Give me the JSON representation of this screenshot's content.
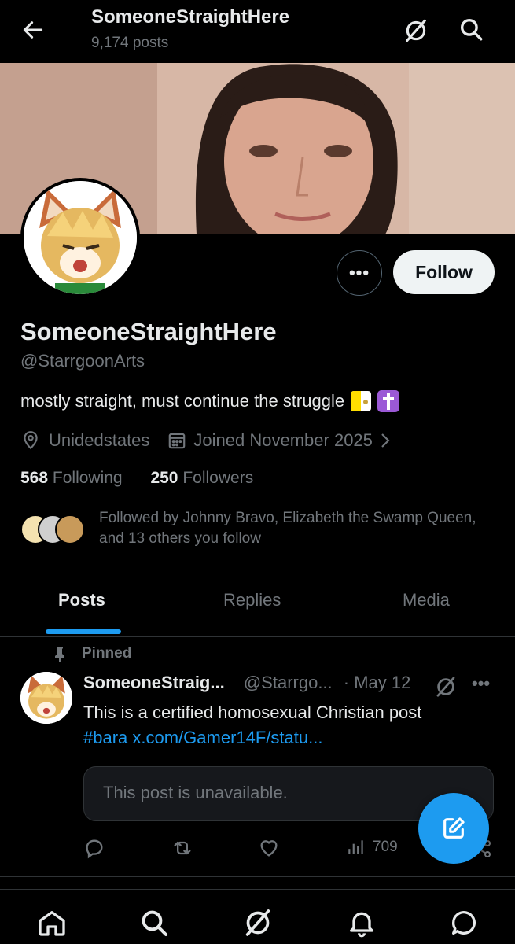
{
  "header": {
    "title": "SomeoneStraightHere",
    "subtitle": "9,174 posts"
  },
  "profile": {
    "name": "SomeoneStraightHere",
    "handle": "@StarrgoonArts",
    "bio": "mostly straight, must continue the struggle",
    "location": "Unidedstates",
    "joined": "Joined November 2025",
    "following_count": "568",
    "following_label": "Following",
    "followers_count": "250",
    "followers_label": "Followers",
    "followed_by": "Followed by Johnny Bravo, Elizabeth the Swamp Queen, and 13 others you follow",
    "follow_label": "Follow",
    "more_label": "•••"
  },
  "tabs": [
    {
      "label": "Posts",
      "active": true
    },
    {
      "label": "Replies",
      "active": false
    },
    {
      "label": "Media",
      "active": false
    }
  ],
  "post": {
    "pinned_label": "Pinned",
    "author_name": "SomeoneStraig...",
    "author_handle": "@Starrgo...",
    "time": "· May 12",
    "text": "This is a certified homosexual Christian post",
    "link": "#bara x.com/Gamer14F/statu...",
    "unavailable": "This post is unavailable.",
    "views": "709",
    "more_label": "•••"
  },
  "colors": {
    "accent": "#1d9bf0",
    "background": "#000000",
    "muted": "#71767b",
    "text": "#e7e9ea"
  },
  "icons": {
    "back": "arrow-left-icon",
    "grok": "grok-icon",
    "search": "search-icon",
    "location": "location-pin-icon",
    "calendar": "calendar-icon",
    "pin": "pin-icon",
    "reply": "reply-icon",
    "repost": "repost-icon",
    "like": "heart-icon",
    "views": "views-icon",
    "share": "share-icon",
    "compose": "compose-icon",
    "home": "home-icon",
    "notifications": "bell-icon",
    "messages": "message-icon"
  }
}
